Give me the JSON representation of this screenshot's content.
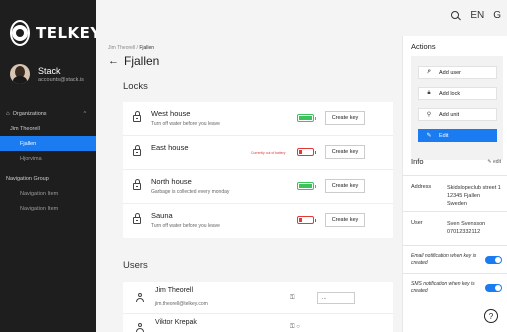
{
  "brand": {
    "name": "TELKEY"
  },
  "profile": {
    "name": "Stack",
    "email": "accounts@stack.is"
  },
  "sidebar": {
    "organizations_label": "Organizations",
    "items": [
      {
        "label": "Jim Theorell"
      },
      {
        "label": "Fjallen"
      },
      {
        "label": "Hjorvima"
      }
    ],
    "navigation_group_label": "Navigation Group",
    "nav_items": [
      {
        "label": "Navigation Item"
      },
      {
        "label": "Navigation Item"
      }
    ]
  },
  "topbar": {
    "lang": "EN",
    "extra_glyph": "G"
  },
  "breadcrumb": {
    "parent": "Jim Theorell",
    "separator": "/",
    "current": "Fjallen"
  },
  "page": {
    "title": "Fjallen"
  },
  "locks": {
    "title": "Locks",
    "create_key_label": "Create key",
    "items": [
      {
        "name": "West house",
        "note": "Turn off water before you leave",
        "battery_level": 1.0,
        "battery_status": "ok",
        "warning": ""
      },
      {
        "name": "East house",
        "note": "",
        "battery_level": 0.2,
        "battery_status": "low",
        "warning": "Currently out of battery"
      },
      {
        "name": "North house",
        "note": "Garbage is collected every monday",
        "battery_level": 1.0,
        "battery_status": "ok",
        "warning": ""
      },
      {
        "name": "Sauna",
        "note": "Turn off water before you leave",
        "battery_level": 0.2,
        "battery_status": "low",
        "warning": ""
      }
    ]
  },
  "users": {
    "title": "Users",
    "items": [
      {
        "name": "Jim Theorell",
        "email": "jim.theorell@telkey.com",
        "key_value": "..."
      },
      {
        "name": "Viktor Krepak",
        "email": "",
        "key_value": ""
      }
    ]
  },
  "actions": {
    "title": "Actions",
    "add_user": "Add user",
    "add_lock": "Add lock",
    "add_unit": "Add unit",
    "edit": "Edit"
  },
  "info": {
    "title": "Info",
    "edit_label": "edit",
    "address_label": "Address",
    "address_lines": [
      "Skidslopeclub street 1",
      "12345 Fjallen",
      "Sweden"
    ],
    "user_label": "User",
    "user_lines": [
      "Sven Svensson",
      "07012332112"
    ],
    "email_notification": "Email notification when key is created",
    "sms_notification": "SMS notification when key is created",
    "email_enabled": true,
    "sms_enabled": true
  },
  "help": {
    "glyph": "?"
  },
  "colors": {
    "accent": "#1a7cf0",
    "sidebar_bg": "#1e1e1e",
    "battery_ok": "#3ac45a",
    "battery_low": "#e23838"
  }
}
